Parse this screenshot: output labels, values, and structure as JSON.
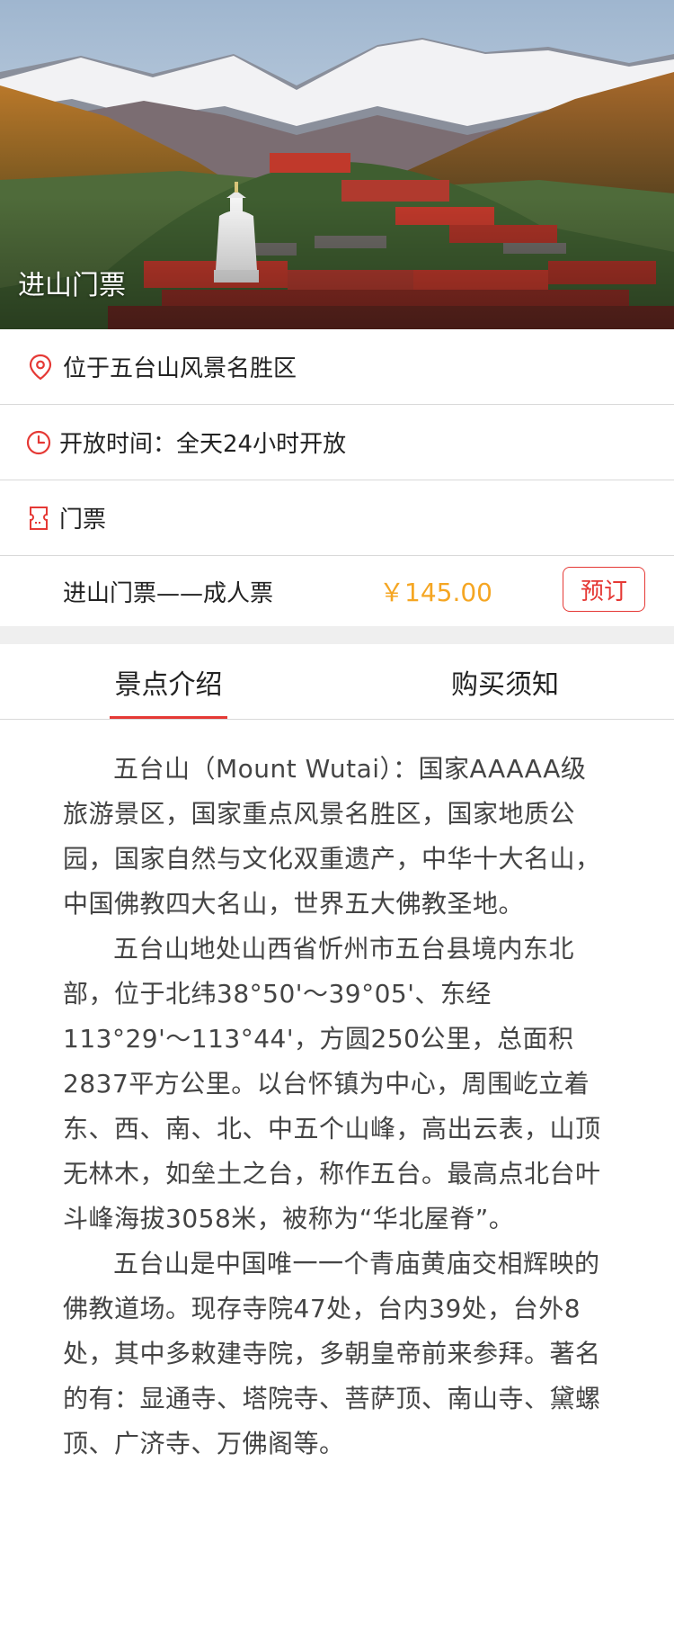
{
  "hero": {
    "title": "进山门票"
  },
  "info": {
    "location": "位于五台山风景名胜区",
    "hours": "开放时间：全天24小时开放",
    "tickets_header": "门票"
  },
  "ticket": {
    "name": "进山门票——成人票",
    "price": "￥145.00",
    "book_label": "预订"
  },
  "tabs": [
    {
      "label": "景点介绍",
      "active": true
    },
    {
      "label": "购买须知",
      "active": false
    }
  ],
  "content": {
    "paragraphs": [
      "五台山（Mount Wutai）：国家AAAAA级旅游景区，国家重点风景名胜区，国家地质公园，国家自然与文化双重遗产，中华十大名山，中国佛教四大名山，世界五大佛教圣地。",
      "五台山地处山西省忻州市五台县境内东北部，位于北纬38°50'～39°05'、东经113°29'～113°44'，方圆250公里，总面积2837平方公里。以台怀镇为中心，周围屹立着东、西、南、北、中五个山峰，高出云表，山顶无林木，如垒土之台，称作五台。最高点北台叶斗峰海拔3058米，被称为“华北屋脊”。",
      "五台山是中国唯一一个青庙黄庙交相辉映的佛教道场。现存寺院47处，台内39处，台外8处，其中多敕建寺院，多朝皇帝前来参拜。著名的有：显通寺、塔院寺、菩萨顶、南山寺、黛螺顶、广济寺、万佛阁等。"
    ]
  },
  "colors": {
    "accent_red": "#e53935",
    "price_orange": "#f5a623",
    "divider": "#d9d9d9"
  },
  "icons": {
    "location": "map-pin-icon",
    "clock": "clock-icon",
    "ticket": "ticket-icon"
  }
}
